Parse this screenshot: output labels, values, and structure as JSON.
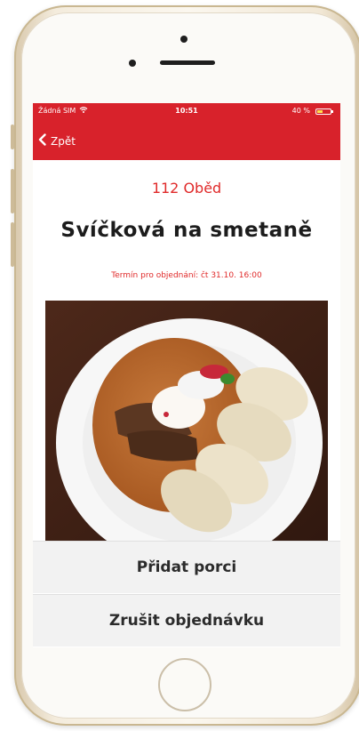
{
  "status_bar": {
    "carrier": "Žádná SIM",
    "time": "10:51",
    "battery": "40 %",
    "battery_level": 0.4
  },
  "nav": {
    "back_label": "Zpět"
  },
  "meal": {
    "category": "112 Oběd",
    "name": "Svíčková na smetaně",
    "deadline": "Termín pro objednání: čt 31.10. 16:00"
  },
  "actions": {
    "add_portion": "Přidat porci",
    "cancel_order": "Zrušit objednávku"
  },
  "colors": {
    "accent": "#d8222b",
    "accent_text": "#e02a2a",
    "button_bg": "#f2f2f2"
  },
  "icons": {
    "back": "chevron-left-icon",
    "wifi": "wifi-icon",
    "battery": "battery-icon"
  }
}
